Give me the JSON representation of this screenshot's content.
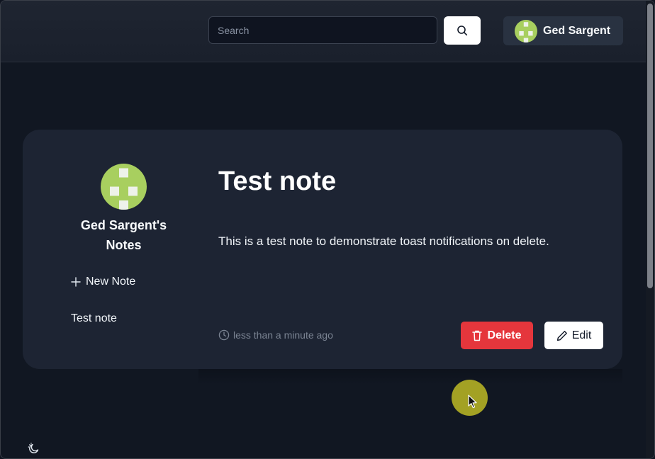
{
  "header": {
    "search": {
      "placeholder": "Search",
      "value": ""
    },
    "search_button_icon": "magnifier-icon",
    "user": {
      "name": "Ged Sargent",
      "avatar_icon": "identicon-avatar"
    }
  },
  "sidebar": {
    "owner_title": "Ged Sargent's Notes",
    "new_note_label": "New Note",
    "notes": [
      {
        "label": "Test note"
      }
    ]
  },
  "note": {
    "title": "Test note",
    "body": "This is a test note to demonstrate toast notifications on delete.",
    "timestamp": "less than a minute ago",
    "delete_label": "Delete",
    "edit_label": "Edit"
  },
  "footer": {
    "theme_toggle_icon": "moon-sun-icon"
  },
  "colors": {
    "background": "#111722",
    "card": "#1d2433",
    "delete": "#e5363c",
    "avatar_green": "#a8cf5f",
    "cursor_highlight": "#bdba24"
  }
}
